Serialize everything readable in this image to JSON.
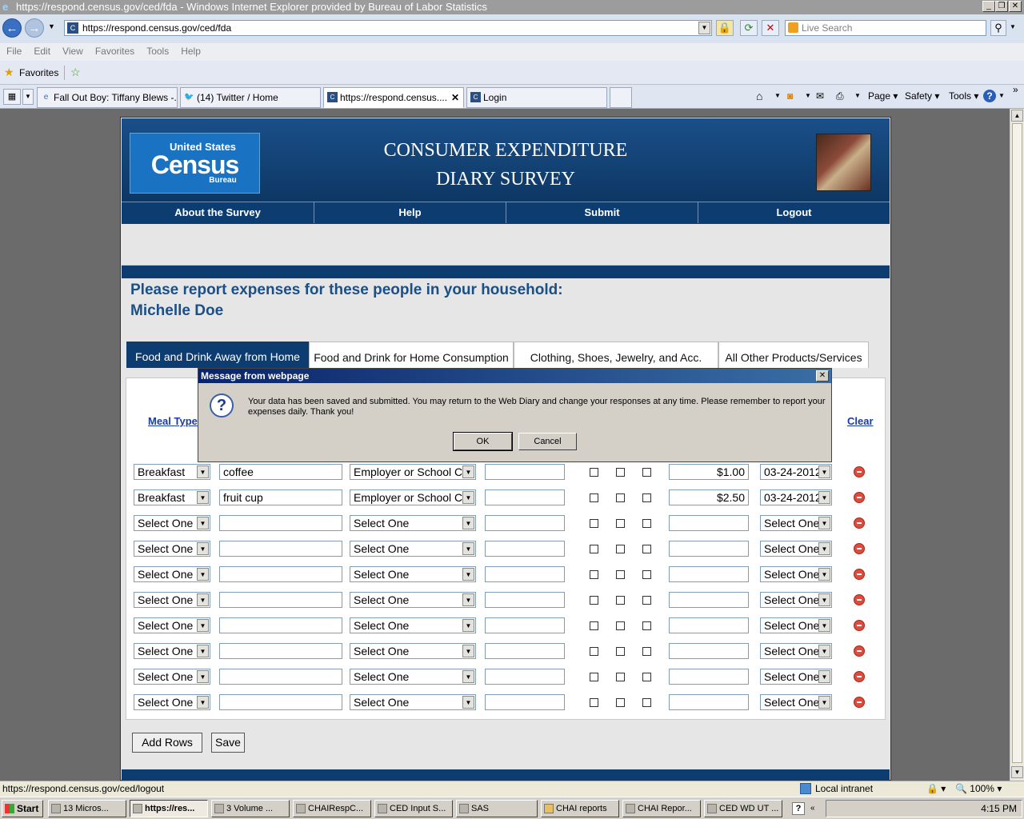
{
  "window": {
    "title": "https://respond.census.gov/ced/fda - Windows Internet Explorer provided by Bureau of Labor Statistics"
  },
  "address": {
    "url": "https://respond.census.gov/ced/fda",
    "search_placeholder": "Live Search"
  },
  "menu": [
    "File",
    "Edit",
    "View",
    "Favorites",
    "Tools",
    "Help"
  ],
  "favorites_label": "Favorites",
  "browser_tabs": [
    {
      "label": "Fall Out Boy: Tiffany Blews -..."
    },
    {
      "label": "(14) Twitter / Home"
    },
    {
      "label": "https://respond.census...."
    },
    {
      "label": "Login"
    }
  ],
  "toolbar_right": {
    "page": "Page",
    "safety": "Safety",
    "tools": "Tools"
  },
  "site": {
    "logo_top": "United States",
    "logo_main": "Census",
    "logo_sub": "Bureau",
    "title_line1": "CONSUMER EXPENDITURE",
    "title_line2": "DIARY SURVEY",
    "nav": [
      "About the Survey",
      "Help",
      "Submit",
      "Logout"
    ],
    "instruction": "Please report expenses for these people in your household:",
    "person": "Michelle Doe",
    "tabs": [
      "Food and Drink Away from Home",
      "Food and Drink for Home Consumption",
      "Clothing, Shoes, Jewelry, and Acc.",
      "All Other Products/Services"
    ],
    "meal_type_header": "Meal Type",
    "clear_link": "Clear",
    "rows": [
      {
        "meal": "Breakfast",
        "desc": "coffee",
        "where": "Employer or School Caf",
        "cost": "$1.00",
        "date": "03-24-2012"
      },
      {
        "meal": "Breakfast",
        "desc": "fruit cup",
        "where": "Employer or School Caf",
        "cost": "$2.50",
        "date": "03-24-2012"
      },
      {
        "meal": "Select One",
        "desc": "",
        "where": "Select One",
        "cost": "",
        "date": "Select One"
      },
      {
        "meal": "Select One",
        "desc": "",
        "where": "Select One",
        "cost": "",
        "date": "Select One"
      },
      {
        "meal": "Select One",
        "desc": "",
        "where": "Select One",
        "cost": "",
        "date": "Select One"
      },
      {
        "meal": "Select One",
        "desc": "",
        "where": "Select One",
        "cost": "",
        "date": "Select One"
      },
      {
        "meal": "Select One",
        "desc": "",
        "where": "Select One",
        "cost": "",
        "date": "Select One"
      },
      {
        "meal": "Select One",
        "desc": "",
        "where": "Select One",
        "cost": "",
        "date": "Select One"
      },
      {
        "meal": "Select One",
        "desc": "",
        "where": "Select One",
        "cost": "",
        "date": "Select One"
      },
      {
        "meal": "Select One",
        "desc": "",
        "where": "Select One",
        "cost": "",
        "date": "Select One"
      }
    ],
    "add_rows": "Add Rows",
    "save": "Save"
  },
  "dialog": {
    "title": "Message from webpage",
    "message": "Your data has been saved and submitted. You may return to the Web Diary and change your responses at any time. Please remember to report your expenses daily. Thank you!",
    "ok": "OK",
    "cancel": "Cancel"
  },
  "status": {
    "url": "https://respond.census.gov/ced/logout",
    "zone": "Local intranet",
    "zoom": "100%"
  },
  "taskbar": {
    "start": "Start",
    "items": [
      "13 Micros...",
      "https://res...",
      "3 Volume ...",
      "CHAIRespC...",
      "CED Input S...",
      "SAS",
      "CHAI reports",
      "CHAI Repor...",
      "CED WD UT ..."
    ],
    "clock": "4:15 PM"
  }
}
